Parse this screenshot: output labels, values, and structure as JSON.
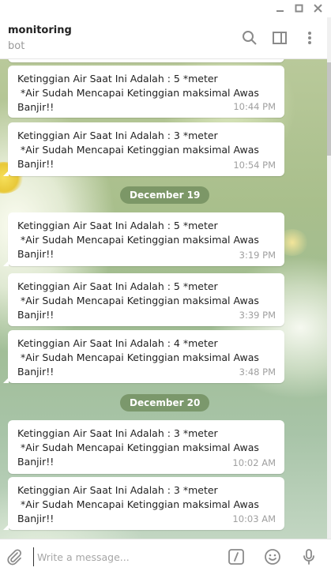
{
  "chat": {
    "title": "monitoring",
    "subtitle": "bot"
  },
  "messages": [
    {
      "text": "Ketinggian Air Saat Ini Adalah : 5 *meter\n *Air Sudah Mencapai Ketinggian maksimal Awas Banjir!!",
      "time": "10:44 PM"
    },
    {
      "text": "Ketinggian Air Saat Ini Adalah : 3 *meter\n *Air Sudah Mencapai Ketinggian maksimal Awas Banjir!!",
      "time": "10:54 PM"
    },
    {
      "text": "Ketinggian Air Saat Ini Adalah : 5 *meter\n *Air Sudah Mencapai Ketinggian maksimal Awas Banjir!!",
      "time": "3:19 PM"
    },
    {
      "text": "Ketinggian Air Saat Ini Adalah : 5 *meter\n *Air Sudah Mencapai Ketinggian maksimal Awas Banjir!!",
      "time": "3:39 PM"
    },
    {
      "text": "Ketinggian Air Saat Ini Adalah : 4 *meter\n *Air Sudah Mencapai Ketinggian maksimal Awas Banjir!!",
      "time": "3:48 PM"
    },
    {
      "text": "Ketinggian Air Saat Ini Adalah : 3 *meter\n *Air Sudah Mencapai Ketinggian maksimal Awas Banjir!!",
      "time": "10:02 AM"
    },
    {
      "text": "Ketinggian Air Saat Ini Adalah : 3 *meter\n *Air Sudah Mencapai Ketinggian maksimal Awas Banjir!!",
      "time": "10:03 AM"
    }
  ],
  "date_separators": [
    "December 19",
    "December 20"
  ],
  "composer": {
    "placeholder": "Write a message..."
  },
  "icons": {
    "window": [
      "minimize-icon",
      "maximize-icon",
      "close-icon"
    ],
    "header": [
      "search-icon",
      "sidebar-toggle-icon",
      "more-vertical-icon"
    ],
    "composer": [
      "attach-icon",
      "bot-command-icon",
      "emoji-icon",
      "microphone-icon"
    ]
  },
  "colors": {
    "bubble": "#ffffff",
    "date_pill": "#708c5c",
    "time": "#a0a0a0",
    "icon": "#8a8a8a"
  }
}
